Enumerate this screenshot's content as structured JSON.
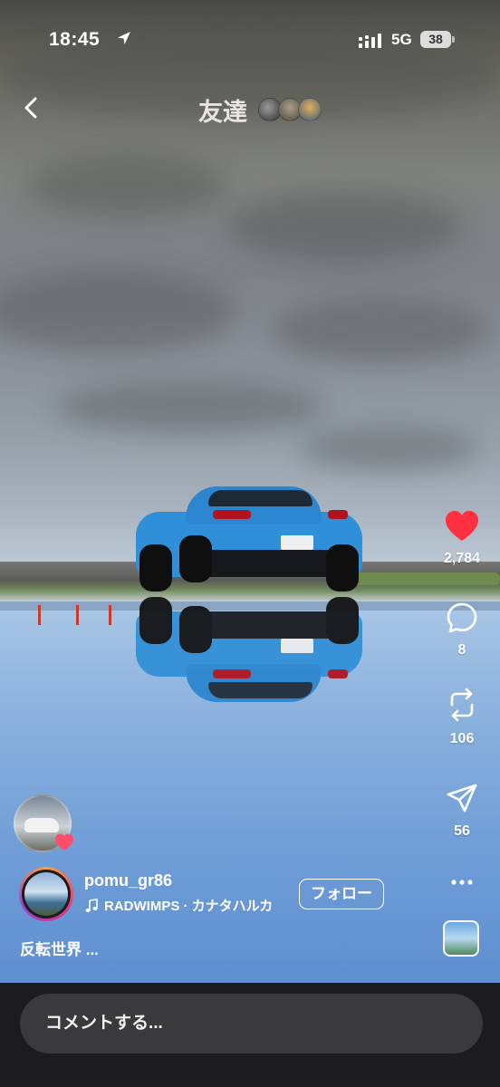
{
  "status_bar": {
    "time": "18:45",
    "network": "5G",
    "battery": "38"
  },
  "header": {
    "title": "友達"
  },
  "rail": {
    "likes": "2,784",
    "comments": "8",
    "reposts": "106",
    "shares": "56"
  },
  "post": {
    "username": "pomu_gr86",
    "music": "RADWIMPS · カナタハルカ",
    "follow_label": "フォロー",
    "caption": "反転世界 ..."
  },
  "comment_bar": {
    "placeholder": "コメントする..."
  },
  "colors": {
    "like_red": "#ff3040",
    "sky_blue": "#6c9bd6",
    "car_blue": "#2f8fd8"
  }
}
